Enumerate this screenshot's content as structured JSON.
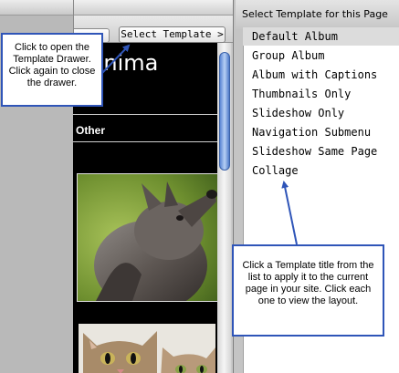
{
  "window": {
    "select_template_button": "Select Template >"
  },
  "page_preview": {
    "title_fragment": "Anima",
    "category_label": "Other"
  },
  "drawer": {
    "header": "Select Template for this Page",
    "templates": [
      {
        "label": "Default Album",
        "selected": true
      },
      {
        "label": "Group Album"
      },
      {
        "label": "Album with Captions"
      },
      {
        "label": "Thumbnails Only"
      },
      {
        "label": "Slideshow Only"
      },
      {
        "label": "Navigation Submenu"
      },
      {
        "label": "Slideshow Same Page"
      },
      {
        "label": "Collage"
      }
    ]
  },
  "callouts": {
    "drawer_toggle": "Click to open the Template Drawer. Click again to close the drawer.",
    "apply_template": "Click a Template title from the list to apply it to the current page in your site. Click each one to view the layout."
  },
  "colors": {
    "callout_border": "#2f55b8",
    "arrow": "#2f55b8",
    "selected_row": "#dcdcdc",
    "preview_background": "#000000"
  }
}
